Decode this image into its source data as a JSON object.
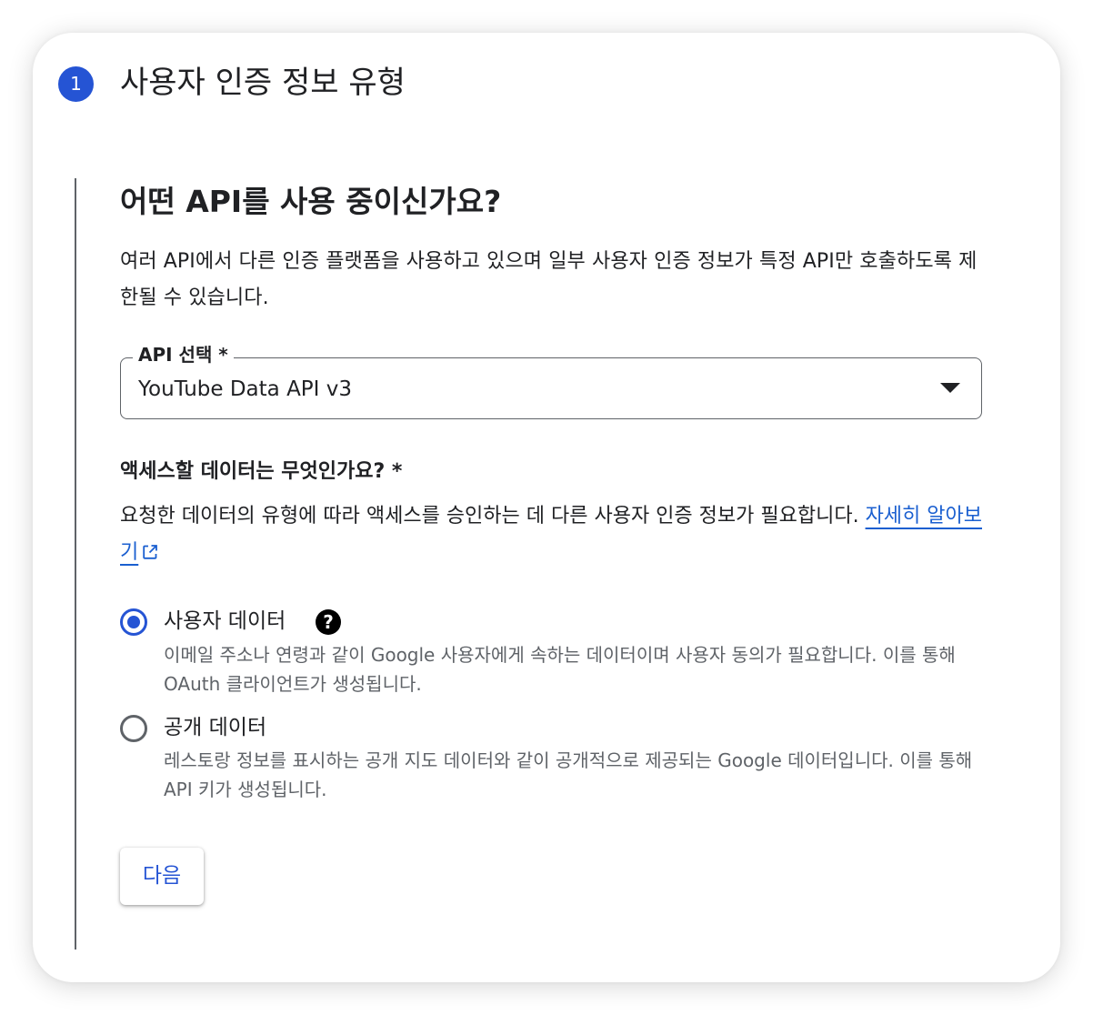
{
  "step": {
    "number": "1",
    "title": "사용자 인증 정보 유형"
  },
  "section": {
    "heading": "어떤 API를 사용 중이신가요?",
    "description": "여러 API에서 다른 인증 플랫폼을 사용하고 있으며 일부 사용자 인증 정보가 특정 API만 호출하도록 제한될 수 있습니다."
  },
  "api_select": {
    "label": "API 선택 *",
    "value": "YouTube Data API v3",
    "icon": "arrow-drop-down-icon"
  },
  "data_access": {
    "question": "액세스할 데이터는 무엇인가요? *",
    "description": "요청한 데이터의 유형에 따라 액세스를 승인하는 데 다른 사용자 인증 정보가 필요합니다.",
    "learn_more": "자세히 알아보기",
    "options": [
      {
        "label": "사용자 데이터",
        "description": "이메일 주소나 연령과 같이 Google 사용자에게 속하는 데이터이며 사용자 동의가 필요합니다. 이를 통해 OAuth 클라이언트가 생성됩니다.",
        "selected": true,
        "help_icon": "?"
      },
      {
        "label": "공개 데이터",
        "description": "레스토랑 정보를 표시하는 공개 지도 데이터와 같이 공개적으로 제공되는 Google 데이터입니다. 이를 통해 API 키가 생성됩니다.",
        "selected": false
      }
    ]
  },
  "next_button": {
    "label": "다음"
  },
  "colors": {
    "accent": "#2554d4",
    "text": "#202124",
    "secondary_text": "#5f6368"
  }
}
